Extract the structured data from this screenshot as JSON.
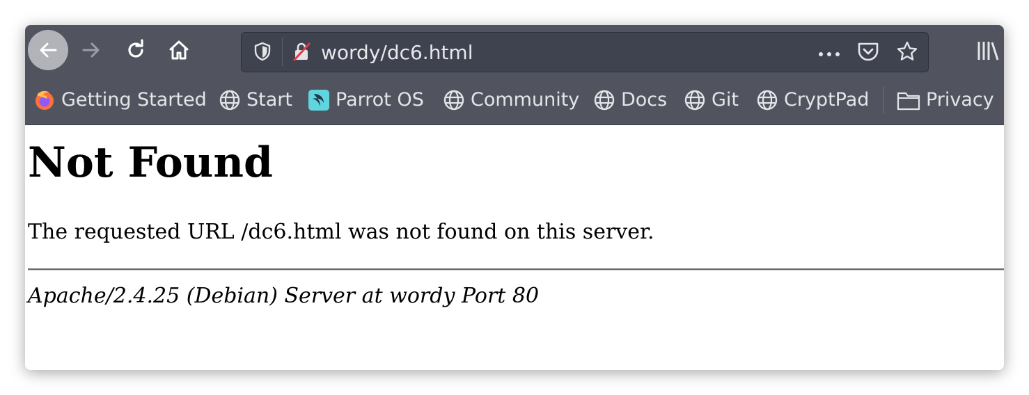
{
  "toolbar": {
    "url": "wordy/dc6.html",
    "icons": {
      "back": "back-arrow-icon",
      "forward": "forward-arrow-icon",
      "reload": "reload-icon",
      "home": "home-icon",
      "tracking": "shield-icon",
      "insecure": "insecure-lock-icon",
      "more": "more-actions-icon",
      "pocket": "pocket-icon",
      "bookmark": "star-icon",
      "library": "library-icon"
    }
  },
  "bookmarks": {
    "items": [
      {
        "label": "Getting Started",
        "icon": "firefox-icon"
      },
      {
        "label": "Start",
        "icon": "globe-icon"
      },
      {
        "label": "Parrot OS",
        "icon": "parrot-icon"
      },
      {
        "label": "Community",
        "icon": "globe-icon"
      },
      {
        "label": "Docs",
        "icon": "globe-icon"
      },
      {
        "label": "Git",
        "icon": "globe-icon"
      },
      {
        "label": "CryptPad",
        "icon": "globe-icon"
      },
      {
        "label": "Privacy",
        "icon": "folder-icon"
      }
    ]
  },
  "page": {
    "title": "Not Found",
    "message": "The requested URL /dc6.html was not found on this server.",
    "address": "Apache/2.4.25 (Debian) Server at wordy Port 80"
  },
  "colors": {
    "chrome": "#51545e",
    "urlbar": "#3f4350",
    "parrot_accent": "#5fd5e0"
  }
}
